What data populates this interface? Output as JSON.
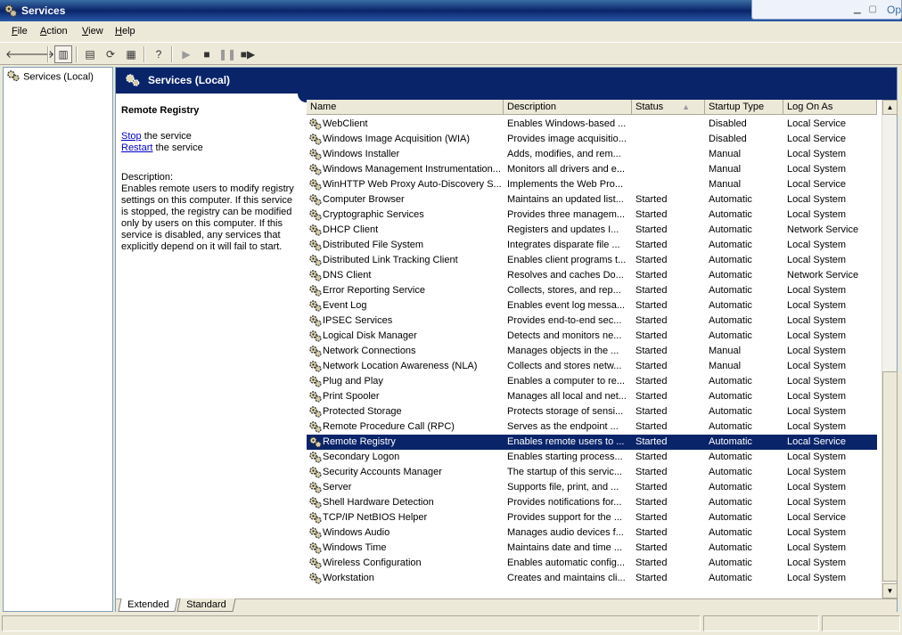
{
  "window": {
    "title": "Services",
    "overlay_label": "Op"
  },
  "menu": [
    {
      "label": "File",
      "accel": "F",
      "rest": "ile"
    },
    {
      "label": "Action",
      "accel": "A",
      "rest": "ction"
    },
    {
      "label": "View",
      "accel": "V",
      "rest": "iew"
    },
    {
      "label": "Help",
      "accel": "H",
      "rest": "elp"
    }
  ],
  "tree": {
    "root": "Services (Local)"
  },
  "pane": {
    "header": "Services (Local)"
  },
  "detail": {
    "title": "Remote Registry",
    "stop_link": "Stop",
    "stop_rest": " the service",
    "restart_link": "Restart",
    "restart_rest": " the service",
    "description_label": "Description:",
    "description": "Enables remote users to modify registry settings on this computer. If this service is stopped, the registry can be modified only by users on this computer. If this service is disabled, any services that explicitly depend on it will fail to start."
  },
  "columns": {
    "name": "Name",
    "description": "Description",
    "status": "Status",
    "startup": "Startup Type",
    "logon": "Log On As"
  },
  "services": [
    {
      "name": "WebClient",
      "description": "Enables Windows-based ...",
      "status": "",
      "startup": "Disabled",
      "logon": "Local Service"
    },
    {
      "name": "Windows Image Acquisition (WIA)",
      "description": "Provides image acquisitio...",
      "status": "",
      "startup": "Disabled",
      "logon": "Local Service"
    },
    {
      "name": "Windows Installer",
      "description": "Adds, modifies, and rem...",
      "status": "",
      "startup": "Manual",
      "logon": "Local System"
    },
    {
      "name": "Windows Management Instrumentation...",
      "description": "Monitors all drivers and e...",
      "status": "",
      "startup": "Manual",
      "logon": "Local System"
    },
    {
      "name": "WinHTTP Web Proxy Auto-Discovery S...",
      "description": "Implements the Web Pro...",
      "status": "",
      "startup": "Manual",
      "logon": "Local Service"
    },
    {
      "name": "Computer Browser",
      "description": "Maintains an updated list...",
      "status": "Started",
      "startup": "Automatic",
      "logon": "Local System"
    },
    {
      "name": "Cryptographic Services",
      "description": "Provides three managem...",
      "status": "Started",
      "startup": "Automatic",
      "logon": "Local System"
    },
    {
      "name": "DHCP Client",
      "description": "Registers and updates I...",
      "status": "Started",
      "startup": "Automatic",
      "logon": "Network Service"
    },
    {
      "name": "Distributed File System",
      "description": "Integrates disparate file ...",
      "status": "Started",
      "startup": "Automatic",
      "logon": "Local System"
    },
    {
      "name": "Distributed Link Tracking Client",
      "description": "Enables client programs t...",
      "status": "Started",
      "startup": "Automatic",
      "logon": "Local System"
    },
    {
      "name": "DNS Client",
      "description": "Resolves and caches Do...",
      "status": "Started",
      "startup": "Automatic",
      "logon": "Network Service"
    },
    {
      "name": "Error Reporting Service",
      "description": "Collects, stores, and rep...",
      "status": "Started",
      "startup": "Automatic",
      "logon": "Local System"
    },
    {
      "name": "Event Log",
      "description": "Enables event log messa...",
      "status": "Started",
      "startup": "Automatic",
      "logon": "Local System"
    },
    {
      "name": "IPSEC Services",
      "description": "Provides end-to-end sec...",
      "status": "Started",
      "startup": "Automatic",
      "logon": "Local System"
    },
    {
      "name": "Logical Disk Manager",
      "description": "Detects and monitors ne...",
      "status": "Started",
      "startup": "Automatic",
      "logon": "Local System"
    },
    {
      "name": "Network Connections",
      "description": "Manages objects in the ...",
      "status": "Started",
      "startup": "Manual",
      "logon": "Local System"
    },
    {
      "name": "Network Location Awareness (NLA)",
      "description": "Collects and stores netw...",
      "status": "Started",
      "startup": "Manual",
      "logon": "Local System"
    },
    {
      "name": "Plug and Play",
      "description": "Enables a computer to re...",
      "status": "Started",
      "startup": "Automatic",
      "logon": "Local System"
    },
    {
      "name": "Print Spooler",
      "description": "Manages all local and net...",
      "status": "Started",
      "startup": "Automatic",
      "logon": "Local System"
    },
    {
      "name": "Protected Storage",
      "description": "Protects storage of sensi...",
      "status": "Started",
      "startup": "Automatic",
      "logon": "Local System"
    },
    {
      "name": "Remote Procedure Call (RPC)",
      "description": "Serves as the endpoint ...",
      "status": "Started",
      "startup": "Automatic",
      "logon": "Local System"
    },
    {
      "name": "Remote Registry",
      "description": "Enables remote users to ...",
      "status": "Started",
      "startup": "Automatic",
      "logon": "Local Service",
      "selected": true
    },
    {
      "name": "Secondary Logon",
      "description": "Enables starting process...",
      "status": "Started",
      "startup": "Automatic",
      "logon": "Local System"
    },
    {
      "name": "Security Accounts Manager",
      "description": "The startup of this servic...",
      "status": "Started",
      "startup": "Automatic",
      "logon": "Local System"
    },
    {
      "name": "Server",
      "description": "Supports file, print, and ...",
      "status": "Started",
      "startup": "Automatic",
      "logon": "Local System"
    },
    {
      "name": "Shell Hardware Detection",
      "description": "Provides notifications for...",
      "status": "Started",
      "startup": "Automatic",
      "logon": "Local System"
    },
    {
      "name": "TCP/IP NetBIOS Helper",
      "description": "Provides support for the ...",
      "status": "Started",
      "startup": "Automatic",
      "logon": "Local Service"
    },
    {
      "name": "Windows Audio",
      "description": "Manages audio devices f...",
      "status": "Started",
      "startup": "Automatic",
      "logon": "Local System"
    },
    {
      "name": "Windows Time",
      "description": "Maintains date and time ...",
      "status": "Started",
      "startup": "Automatic",
      "logon": "Local System"
    },
    {
      "name": "Wireless Configuration",
      "description": "Enables automatic config...",
      "status": "Started",
      "startup": "Automatic",
      "logon": "Local System"
    },
    {
      "name": "Workstation",
      "description": "Creates and maintains cli...",
      "status": "Started",
      "startup": "Automatic",
      "logon": "Local System"
    }
  ],
  "tabs": [
    {
      "label": "Extended",
      "active": true
    },
    {
      "label": "Standard",
      "active": false
    }
  ],
  "toolbar": [
    "back-icon",
    "forward-icon",
    "show-hide-tree-icon",
    "properties-icon",
    "refresh-icon",
    "export-list-icon",
    "help-icon",
    "start-service-icon",
    "stop-service-icon",
    "pause-service-icon",
    "restart-service-icon"
  ],
  "colors": {
    "titlebar": "#0a246a",
    "selection": "#0a246a",
    "face": "#ece9d8",
    "link": "#0000cc"
  }
}
